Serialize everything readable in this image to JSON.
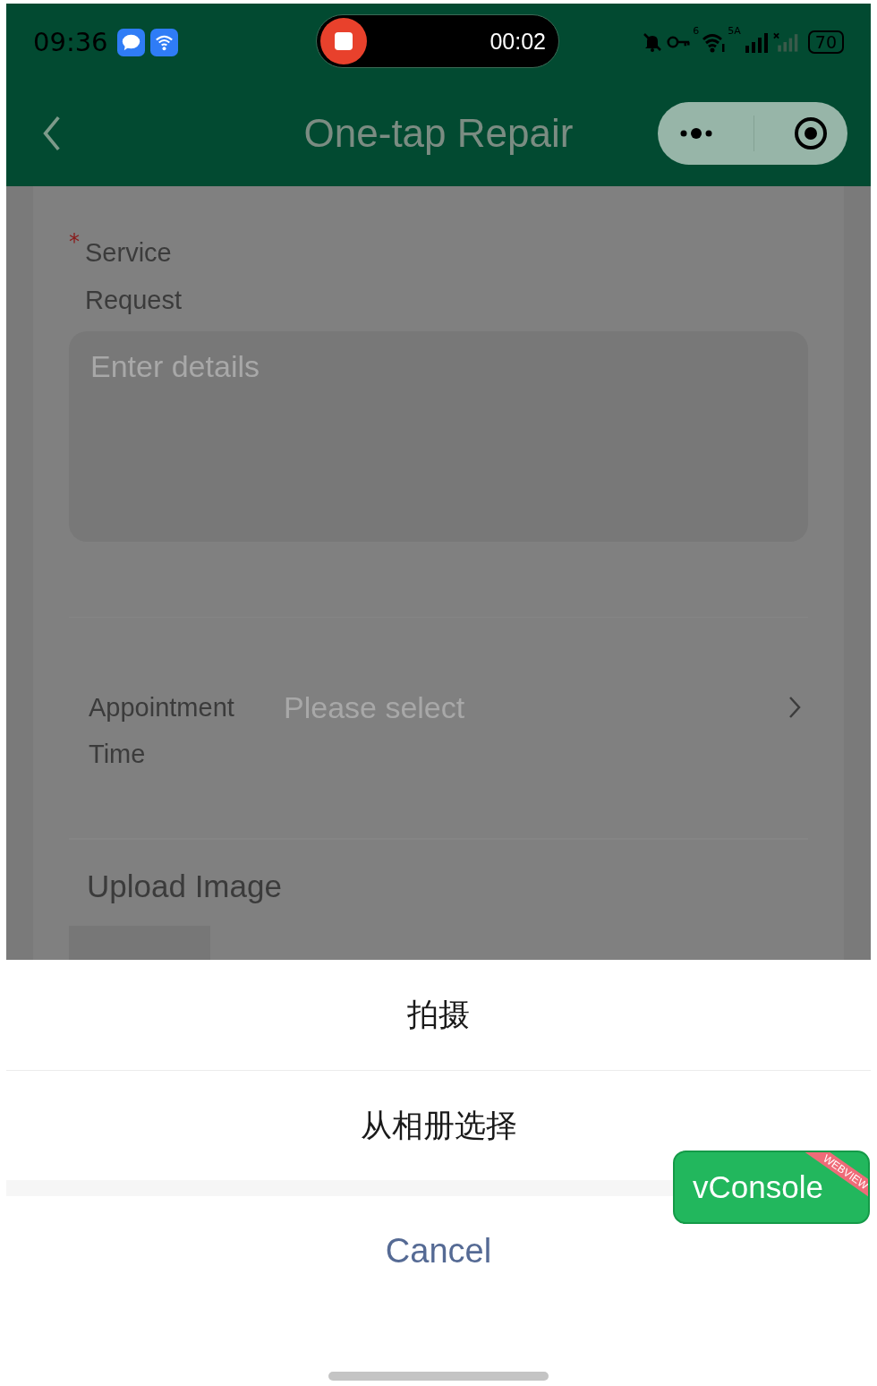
{
  "status_bar": {
    "time": "09:36",
    "recording_timer": "00:02",
    "wifi_label": "6",
    "network_label": "5A",
    "battery": "70"
  },
  "nav_bar": {
    "title": "One-tap Repair"
  },
  "form": {
    "service_request": {
      "label": "Service Request",
      "required_mark": "*",
      "placeholder": "Enter details"
    },
    "appointment_time": {
      "label": "Appointment Time",
      "placeholder": "Please select"
    },
    "upload_image": {
      "label": "Upload Image"
    }
  },
  "action_sheet": {
    "options": [
      "拍摄",
      "从相册选择"
    ],
    "cancel": "Cancel"
  },
  "vconsole": {
    "label": "vConsole",
    "ribbon": "WEBVIEW"
  }
}
